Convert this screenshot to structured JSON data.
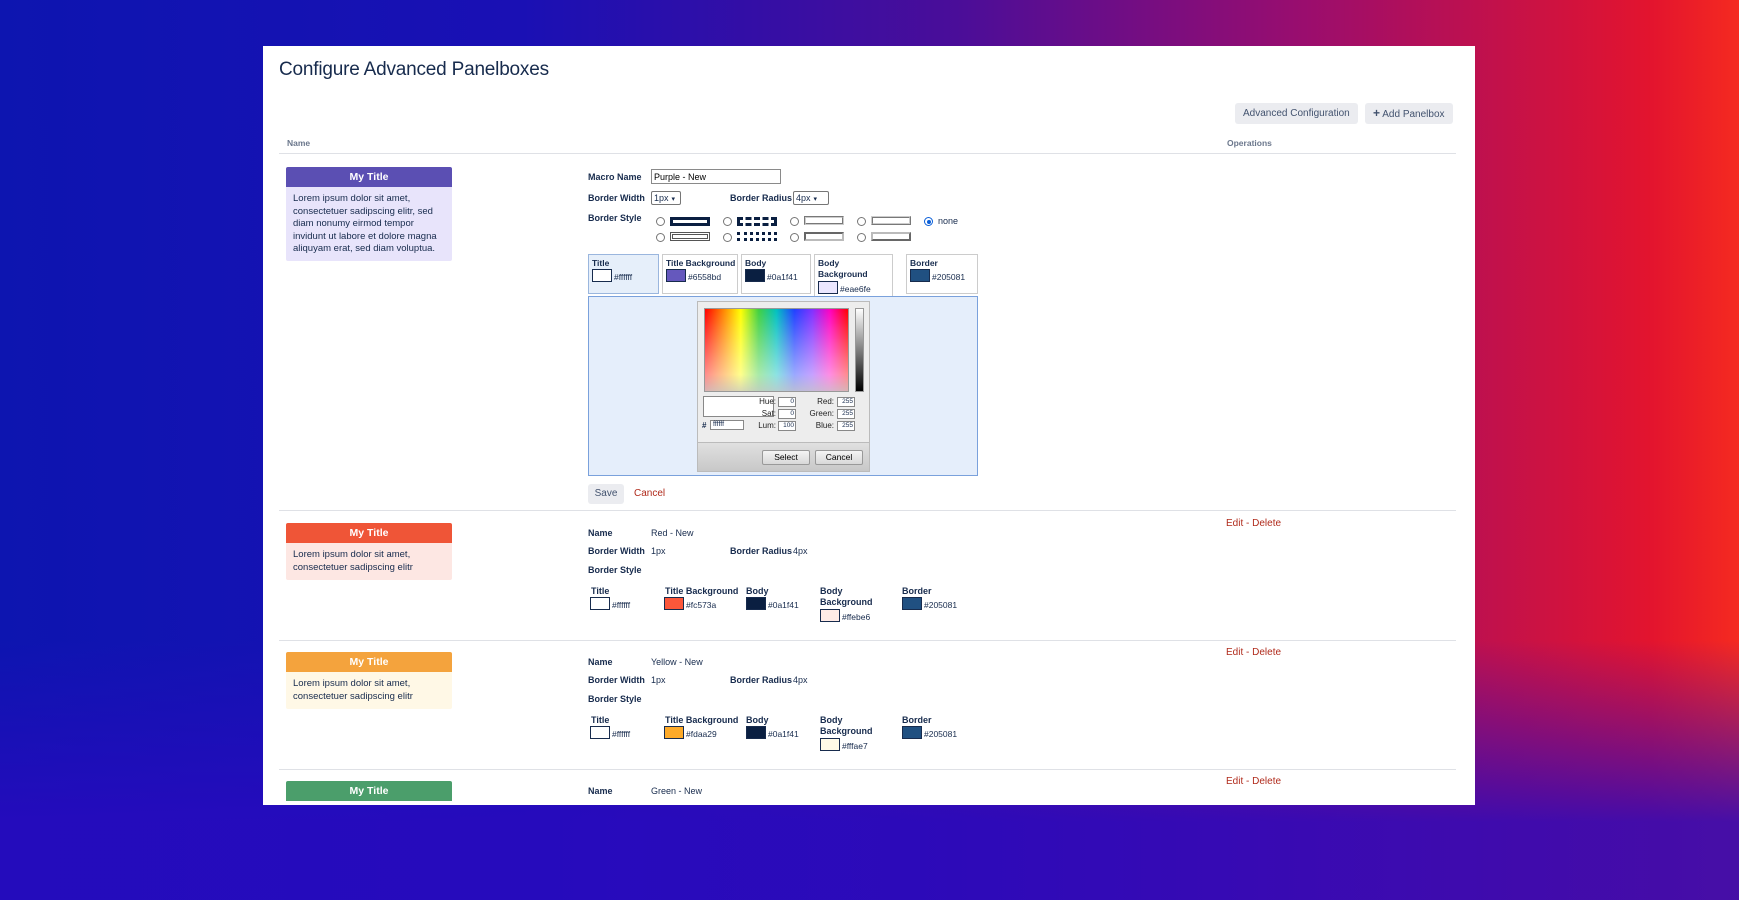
{
  "page": {
    "title": "Configure Advanced Panelboxes"
  },
  "toolbar": {
    "advanced_label": "Advanced Configuration",
    "add_label": "Add Panelbox",
    "add_icon": "plus-icon"
  },
  "table": {
    "col_name": "Name",
    "col_operations": "Operations"
  },
  "preview_text": {
    "title": "My Title",
    "long_body": "Lorem ipsum dolor sit amet, consectetuer sadipscing elitr, sed diam nonumy eirmod tempor invidunt ut labore et dolore magna aliquyam erat, sed diam voluptua.",
    "short_body": "Lorem ipsum dolor sit amet, consectetuer sadipscing elitr"
  },
  "editor": {
    "macro_name_label": "Macro Name",
    "macro_name_value": "Purple - New",
    "border_width_label": "Border Width",
    "border_width_value": "1px",
    "border_radius_label": "Border Radius",
    "border_radius_value": "4px",
    "border_style_label": "Border Style",
    "none_label": "none",
    "colors": {
      "title_label": "Title",
      "title_hex": "#ffffff",
      "title_bg_label": "Title Background",
      "title_bg_hex": "#6558bd",
      "body_label": "Body",
      "body_hex": "#0a1f41",
      "body_bg_label": "Body Background",
      "body_bg_hex": "#eae6fe",
      "border_label": "Border",
      "border_hex": "#205081"
    },
    "picker": {
      "hue_label": "Hue:",
      "hue": "0",
      "sat_label": "Sat:",
      "sat": "0",
      "lum_label": "Lum:",
      "lum": "100",
      "red_label": "Red:",
      "red": "255",
      "green_label": "Green:",
      "green": "255",
      "blue_label": "Blue:",
      "blue": "255",
      "hash": "#",
      "hex": "ffffff",
      "select_label": "Select",
      "cancel_label": "Cancel"
    },
    "save_label": "Save",
    "cancel_label": "Cancel"
  },
  "rows": [
    {
      "name_label": "Name",
      "name": "Red - New",
      "bw_label": "Border Width",
      "bw": "1px",
      "br_label": "Border Radius",
      "br": "4px",
      "bs_label": "Border Style",
      "title_label": "Title",
      "title_hex": "#ffffff",
      "tbg_label": "Title Background",
      "tbg_hex": "#fc573a",
      "body_label": "Body",
      "body_hex": "#0a1f41",
      "bbg_label": "Body Background",
      "bbg_hex": "#ffebe6",
      "border_label": "Border",
      "border_hex": "#205081",
      "edit": "Edit",
      "sep": "-",
      "delete": "Delete"
    },
    {
      "name_label": "Name",
      "name": "Yellow - New",
      "bw_label": "Border Width",
      "bw": "1px",
      "br_label": "Border Radius",
      "br": "4px",
      "bs_label": "Border Style",
      "title_label": "Title",
      "title_hex": "#ffffff",
      "tbg_label": "Title Background",
      "tbg_hex": "#fdaa29",
      "body_label": "Body",
      "body_hex": "#0a1f41",
      "bbg_label": "Body Background",
      "bbg_hex": "#fffae7",
      "border_label": "Border",
      "border_hex": "#205081",
      "edit": "Edit",
      "sep": "-",
      "delete": "Delete"
    },
    {
      "name_label": "Name",
      "name": "Green - New",
      "edit": "Edit",
      "sep": "-",
      "delete": "Delete"
    }
  ],
  "colors": {
    "purple_title_bg": "#5b4fb3",
    "purple_body_bg": "#e8e4fb",
    "red_title_bg": "#ef5537",
    "red_body_bg": "#fde7e3",
    "yellow_title_bg": "#f4a33d",
    "yellow_body_bg": "#fff8e6",
    "green_title_bg": "#4b9e6b",
    "link_red": "#b02a1b"
  }
}
